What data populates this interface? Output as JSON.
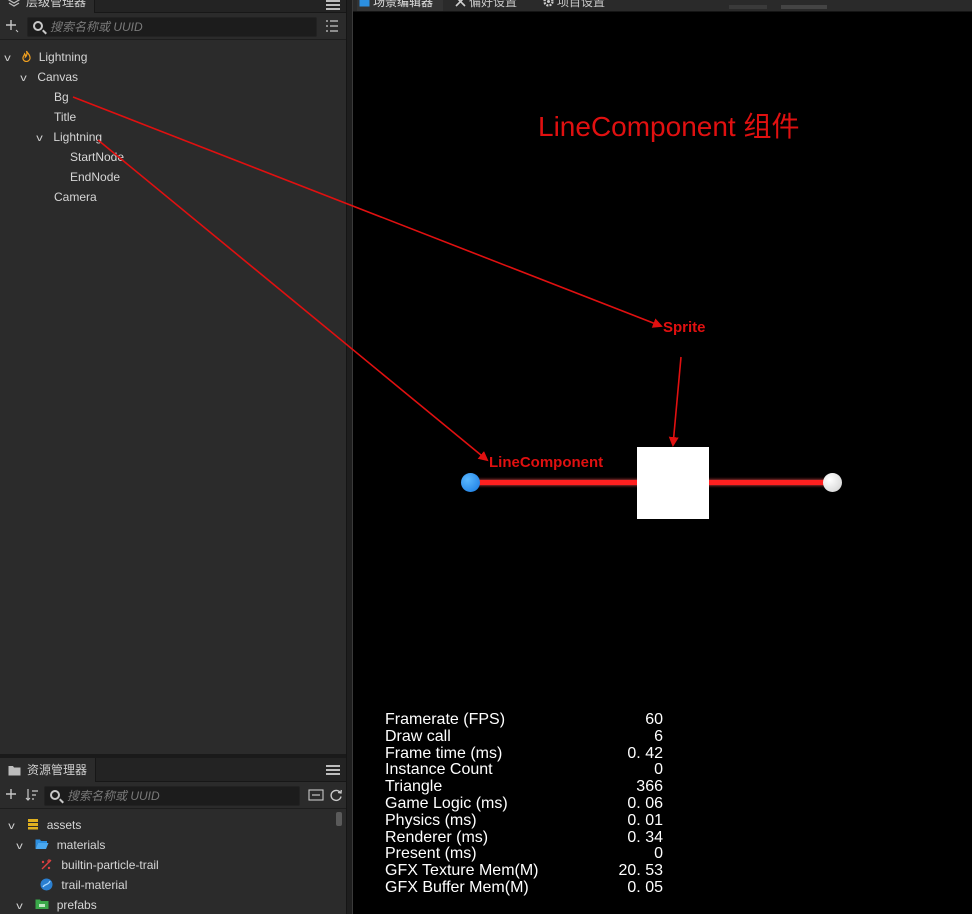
{
  "hierarchy": {
    "title": "层级管理器",
    "search_placeholder": "搜索名称或 UUID",
    "nodes": [
      {
        "label": "Lightning",
        "depth": 0,
        "expanded": true
      },
      {
        "label": "Canvas",
        "depth": 1,
        "expanded": true
      },
      {
        "label": "Bg",
        "depth": 2
      },
      {
        "label": "Title",
        "depth": 2
      },
      {
        "label": "Lightning",
        "depth": 2,
        "expanded": true
      },
      {
        "label": "StartNode",
        "depth": 3
      },
      {
        "label": "EndNode",
        "depth": 3
      },
      {
        "label": "Camera",
        "depth": 2
      }
    ]
  },
  "assets": {
    "title": "资源管理器",
    "search_placeholder": "搜索名称或 UUID",
    "items": [
      {
        "label": "assets",
        "depth": 0,
        "icon": "database-icon"
      },
      {
        "label": "materials",
        "depth": 1,
        "icon": "folder-open-icon"
      },
      {
        "label": "builtin-particle-trail",
        "depth": 2,
        "icon": "particle-icon"
      },
      {
        "label": "trail-material",
        "depth": 2,
        "icon": "material-icon"
      },
      {
        "label": "prefabs",
        "depth": 1,
        "icon": "folder-icon"
      }
    ]
  },
  "scene_tabs": [
    {
      "label": "场景编辑器",
      "active": true
    },
    {
      "label": "偏好设置",
      "active": false
    },
    {
      "label": "项目设置",
      "active": false
    }
  ],
  "scene": {
    "heading": "LineComponent 组件",
    "sprite_label": "Sprite",
    "line_label": "LineComponent",
    "colors": {
      "annotation": "#e01010",
      "line": "#ff2a2a",
      "start_node": "#1e90ff",
      "end_node": "#e8e8e8",
      "sprite": "#ffffff"
    }
  },
  "stats": [
    {
      "label": "Framerate (FPS)",
      "value": "60"
    },
    {
      "label": "Draw call",
      "value": "6"
    },
    {
      "label": "Frame time (ms)",
      "value": "0. 42"
    },
    {
      "label": "Instance Count",
      "value": "0"
    },
    {
      "label": "Triangle",
      "value": "366"
    },
    {
      "label": "Game Logic (ms)",
      "value": "0. 06"
    },
    {
      "label": "Physics (ms)",
      "value": "0. 01"
    },
    {
      "label": "Renderer (ms)",
      "value": "0. 34"
    },
    {
      "label": "Present (ms)",
      "value": "0"
    },
    {
      "label": "GFX Texture Mem(M)",
      "value": "20. 53"
    },
    {
      "label": "GFX Buffer Mem(M)",
      "value": "0. 05"
    }
  ]
}
